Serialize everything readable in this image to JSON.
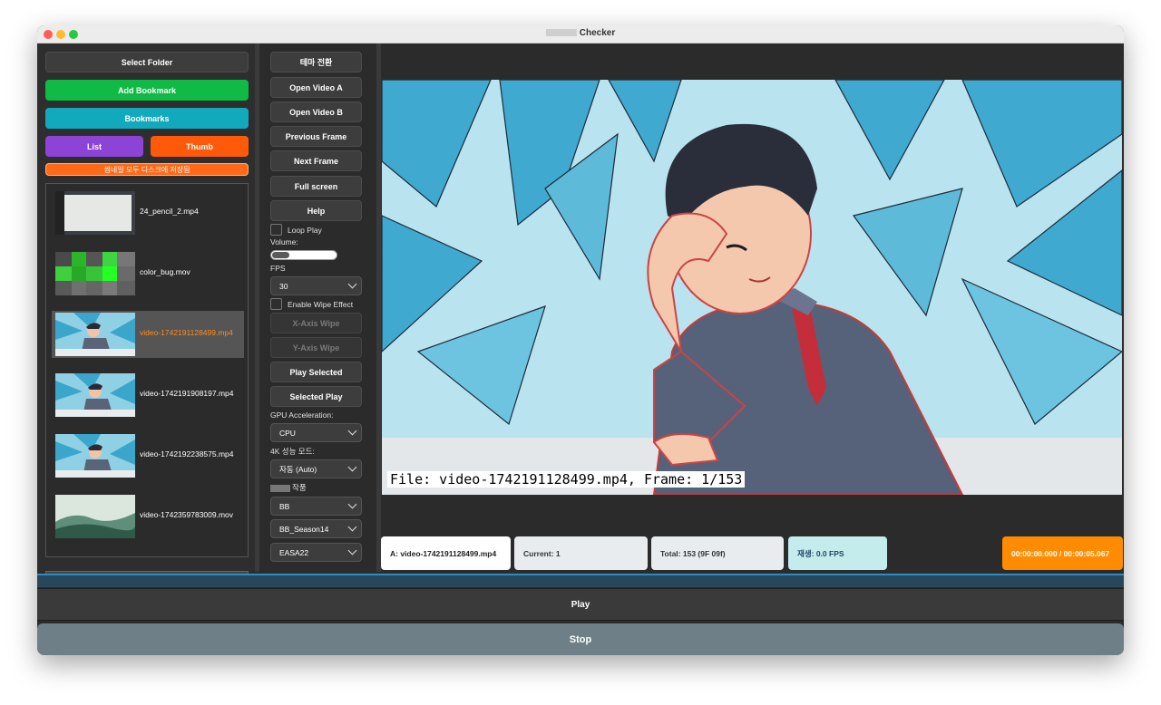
{
  "window": {
    "title": "Checker"
  },
  "sidebar": {
    "select_folder": "Select Folder",
    "add_bookmark": "Add Bookmark",
    "bookmarks": "Bookmarks",
    "list": "List",
    "thumb": "Thumb",
    "save_thumbs": "썸네일 모두 디스크에 저장됨",
    "files": [
      {
        "name": "24_pencil_2.mp4",
        "selected": false
      },
      {
        "name": "color_bug.mov",
        "selected": false
      },
      {
        "name": "video-1742191128499.mp4",
        "selected": true
      },
      {
        "name": "video-1742191908197.mp4",
        "selected": false
      },
      {
        "name": "video-1742192238575.mp4",
        "selected": false
      },
      {
        "name": "video-1742359783009.mov",
        "selected": false
      }
    ]
  },
  "controls": {
    "theme": "테마 전환",
    "open_a": "Open Video A",
    "open_b": "Open Video B",
    "prev_frame": "Previous Frame",
    "next_frame": "Next Frame",
    "full_screen": "Full screen",
    "help": "Help",
    "loop_play": "Loop Play",
    "volume_label": "Volume:",
    "volume_level": 0.1,
    "fps_label": "FPS",
    "fps_value": "30",
    "enable_wipe": "Enable Wipe Effect",
    "x_wipe": "X-Axis Wipe",
    "y_wipe": "Y-Axis Wipe",
    "play_selected": "Play Selected",
    "selected_play": "Selected Play",
    "gpu_label": "GPU Acceleration:",
    "gpu_value": "CPU",
    "perf_label": "4K 성능 모드:",
    "perf_value": "자동 (Auto)",
    "work_label": "작품",
    "work_value": "BB",
    "season_value": "BB_Season14",
    "episode_value": "EASA22"
  },
  "video": {
    "caption": "File: video-1742191128499.mp4, Frame: 1/153"
  },
  "status": {
    "file_a": "A: video-1742191128499.mp4",
    "current": "Current: 1",
    "total": "Total: 153 (9F 09f)",
    "fps": "재생: 0.0 FPS",
    "timecode": "00:00:00.000 / 00:00:05.067"
  },
  "transport": {
    "play": "Play",
    "stop": "Stop"
  },
  "colors": {
    "green": "#0fba45",
    "teal": "#12a9bd",
    "purple": "#8c43d6",
    "orange": "#ff5a0a",
    "timecode_bg": "#ff8c00"
  }
}
